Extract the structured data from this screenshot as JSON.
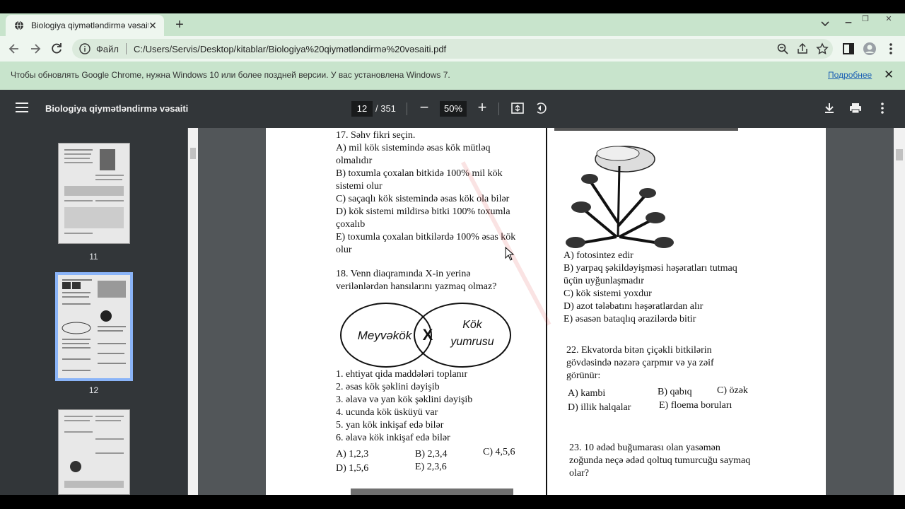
{
  "browser": {
    "tab_title": "Biologiya qiymətləndirmə vəsaiti",
    "site_label": "Файл",
    "url": "C:/Users/Servis/Desktop/kitablar/Biologiya%20qiymətləndirmə%20vəsaiti.pdf"
  },
  "infobar": {
    "message": "Чтобы обновлять Google Chrome, нужна Windows 10 или более поздней версии. У вас установлена Windows 7.",
    "link": "Подробнее"
  },
  "pdf_toolbar": {
    "title": "Biologiya qiymətləndirmə vəsaiti",
    "current_page": "12",
    "total_pages": "/ 351",
    "zoom": "50%"
  },
  "thumbnails": [
    {
      "page": "11"
    },
    {
      "page": "12"
    }
  ],
  "page_content": {
    "left_column": [
      "17. Səhv fikri seçin.",
      "A) mil kök sistemində əsas kök mütləq",
      "olmalıdır",
      "B) toxumla çoxalan bitkidə 100% mil kök",
      "sistemi olur",
      "C) saçaqlı kök sistemində əsas kök ola bilər",
      "D) kök sistemi mildirsə bitki 100% toxumla",
      "çoxalıb",
      "E) toxumla çoxalan bitkilərdə 100% əsas kök",
      "olur"
    ],
    "q18": [
      "18. Venn diaqramında X-in yerinə",
      "verilənlərdən hansılarını yazmaq olmaz?"
    ],
    "venn": {
      "left": "Meyvəkök",
      "center": "X",
      "right_line1": "Kök",
      "right_line2": "yumrusu"
    },
    "q18_items": [
      "1. ehtiyat qida maddələri toplanır",
      "2. əsas kök şəklini dəyişib",
      "3. əlavə və yan kök şəklini dəyişib",
      "4. ucunda kök üsküyü var",
      "5. yan kök inkişaf edə bilər",
      "6. əlavə kök inkişaf edə bilər"
    ],
    "q18_answers": {
      "a": "A) 1,2,3",
      "b": "B) 2,3,4",
      "c": "C) 4,5,6",
      "d": "D) 1,5,6",
      "e": "E) 2,3,6"
    },
    "q21_options": [
      "A) fotosintez edir",
      "B) yarpaq şəkildəyişməsi həşəratları tutmaq",
      "üçün uyğunlaşmadır",
      "C) kök sistemi yoxdur",
      "D) azot tələbatını  həşəratlardan alır",
      "E) əsasən bataqlıq ərazilərdə bitir"
    ],
    "q22": [
      "22. Ekvatorda bitən çiçəkli bitkilərin",
      "gövdəsində nəzərə çarpmır və ya zəif",
      "görünür:"
    ],
    "q22_answers": {
      "a": "A) kambi",
      "b": "B) qabıq",
      "c": "C) özək",
      "d": "D) illik halqalar",
      "e": "E) floema boruları"
    },
    "q23": [
      "23. 10 ədəd buğumarası olan yasəmən",
      "zoğunda neçə ədəd qoltuq tumurcuğu saymaq",
      "olar?"
    ]
  },
  "colors": {
    "chrome_bg": "#c8e4cc",
    "pdf_toolbar": "#323639",
    "viewer_bg": "#525659",
    "link": "#1a5fb4",
    "thumb_selected": "#8ab4f8"
  }
}
